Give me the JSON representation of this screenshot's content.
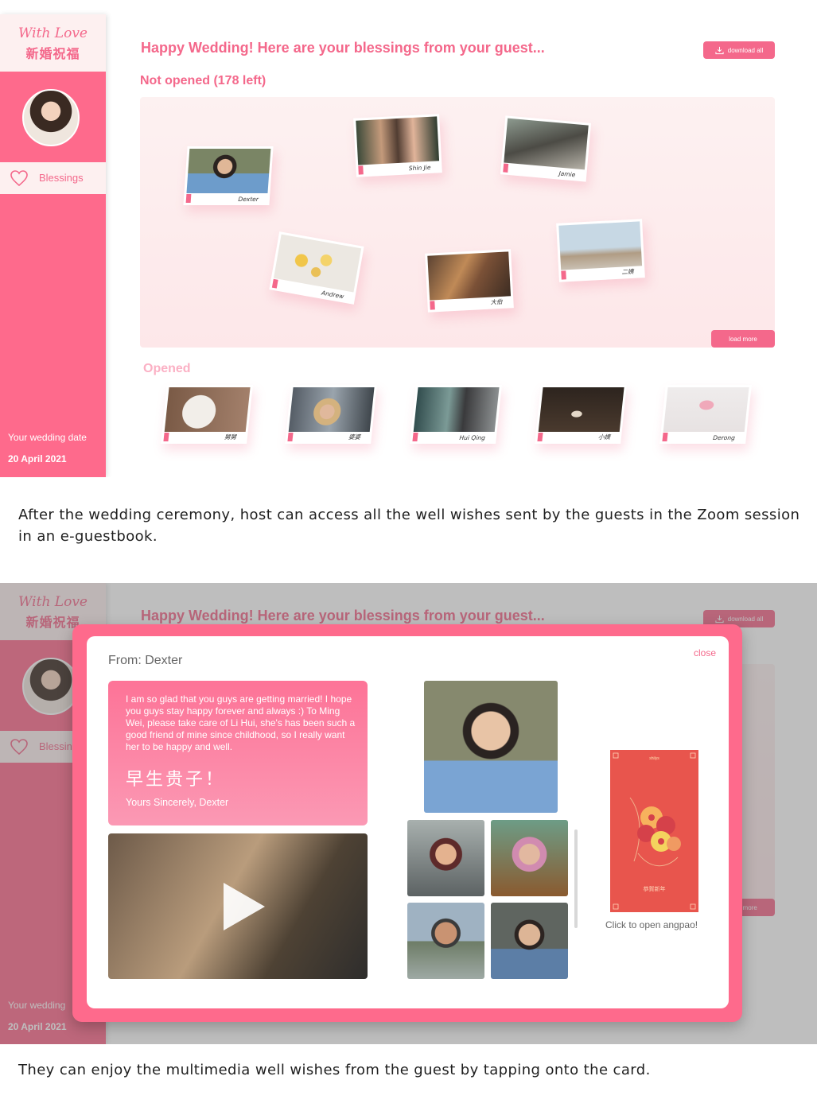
{
  "brand": {
    "script": "With Love",
    "chinese": "新婚祝福"
  },
  "sidebar": {
    "nav": [
      {
        "label": "Blessings"
      }
    ],
    "wedding_date_label": "Your wedding date",
    "wedding_date_value": "20 April 2021",
    "wedding_date_label_partial": "Your wedding"
  },
  "header": {
    "title": "Happy Wedding! Here are your blessings from your guest...",
    "download_label": "download all"
  },
  "not_opened": {
    "title": "Not opened (178 left)",
    "load_more_label": "load more",
    "cards": [
      {
        "name": "Dexter"
      },
      {
        "name": "Shin Jie"
      },
      {
        "name": "Jamie"
      },
      {
        "name": "Andrew"
      },
      {
        "name": "大伯"
      },
      {
        "name": "二姨"
      }
    ]
  },
  "opened": {
    "title": "Opened",
    "cards": [
      {
        "name": "舅舅"
      },
      {
        "name": "婆婆"
      },
      {
        "name": "Hui Qing"
      },
      {
        "name": "小姨"
      },
      {
        "name": "Derong"
      }
    ]
  },
  "captions": {
    "first": "After the wedding ceremony, host can access all the well wishes sent by the guests in the Zoom session in an e-guestbook.",
    "second": "They can enjoy the multimedia well wishes from the guest by tapping onto the card."
  },
  "modal": {
    "from": "From:  Dexter",
    "close_label": "close",
    "message": "I am so glad that you guys are getting married!  I hope you guys stay happy forever and always :) To Ming Wei, please take care of Li Hui, she's has been such a good friend of mine since childhood, so I really want her to be happy and well.",
    "message_chinese": "早生贵子！",
    "signature": "Yours Sincerely, Dexter",
    "angpao_caption": "Click to open angpao!",
    "angpao_text": "恭賀新年",
    "angpao_brand": "shilys"
  },
  "colors": {
    "accent": "#f4688b",
    "sidebar": "#fe6a8c",
    "soft": "#fdf0f0",
    "angpao": "#e8554d"
  }
}
